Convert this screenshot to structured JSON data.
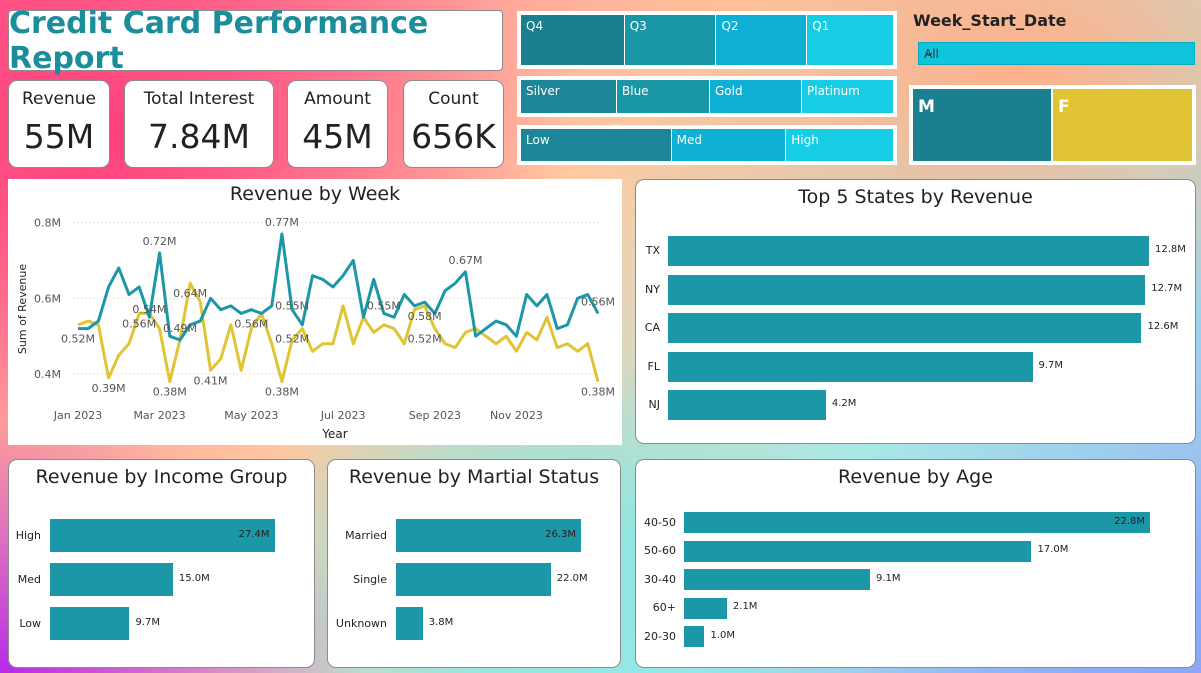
{
  "title": "Credit Card Performance Report",
  "kpis": [
    {
      "label": "Revenue",
      "value": "55M"
    },
    {
      "label": "Total Interest",
      "value": "7.84M"
    },
    {
      "label": "Amount",
      "value": "45M"
    },
    {
      "label": "Count",
      "value": "656K"
    }
  ],
  "slicers": {
    "quarters": [
      "Q4",
      "Q3",
      "Q2",
      "Q1"
    ],
    "card_categories": [
      "Silver",
      "Blue",
      "Gold",
      "Platinum"
    ],
    "levels": [
      "Low",
      "Med",
      "High"
    ]
  },
  "week_filter": {
    "label": "Week_Start_Date",
    "value": "All"
  },
  "gender": [
    "M",
    "F"
  ],
  "colors": {
    "teal": "#1b97a7",
    "yellow": "#e0c434",
    "title": "#1a8e9a"
  },
  "icons": {
    "dropdown": "chevron-down-icon"
  },
  "chart_data": [
    {
      "type": "line",
      "title": "Revenue by Week",
      "xlabel": "Year",
      "ylabel": "Sum of Revenue",
      "ylim": [
        0.35,
        0.82
      ],
      "y_ticks": [
        "0.8M",
        "0.6M",
        "0.4M"
      ],
      "y_tick_values": [
        0.8,
        0.6,
        0.4
      ],
      "x_ticks": [
        "Jan 2023",
        "Mar 2023",
        "May 2023",
        "Jul 2023",
        "Sep 2023",
        "Nov 2023"
      ],
      "x_tick_weeks": [
        1,
        9,
        18,
        27,
        36,
        44
      ],
      "x": [
        1,
        2,
        3,
        4,
        5,
        6,
        7,
        8,
        9,
        10,
        11,
        12,
        13,
        14,
        15,
        16,
        17,
        18,
        19,
        20,
        21,
        22,
        23,
        24,
        25,
        26,
        27,
        28,
        29,
        30,
        31,
        32,
        33,
        34,
        35,
        36,
        37,
        38,
        39,
        40,
        41,
        42,
        43,
        44,
        45,
        46,
        47,
        48,
        49,
        50,
        51,
        52
      ],
      "series": [
        {
          "values": [
            0.52,
            0.52,
            0.54,
            0.63,
            0.68,
            0.61,
            0.63,
            0.55,
            0.72,
            0.5,
            0.49,
            0.53,
            0.54,
            0.6,
            0.57,
            0.58,
            0.56,
            0.57,
            0.56,
            0.58,
            0.77,
            0.57,
            0.53,
            0.66,
            0.65,
            0.63,
            0.66,
            0.7,
            0.55,
            0.65,
            0.56,
            0.55,
            0.61,
            0.58,
            0.59,
            0.56,
            0.62,
            0.64,
            0.67,
            0.5,
            0.52,
            0.54,
            0.53,
            0.5,
            0.61,
            0.58,
            0.61,
            0.52,
            0.53,
            0.6,
            0.61,
            0.56
          ]
        },
        {
          "values": [
            0.53,
            0.54,
            0.53,
            0.39,
            0.45,
            0.48,
            0.56,
            0.56,
            0.52,
            0.38,
            0.49,
            0.64,
            0.59,
            0.41,
            0.44,
            0.53,
            0.41,
            0.52,
            0.56,
            0.48,
            0.38,
            0.49,
            0.52,
            0.46,
            0.48,
            0.48,
            0.58,
            0.48,
            0.55,
            0.51,
            0.53,
            0.52,
            0.48,
            0.57,
            0.58,
            0.52,
            0.48,
            0.47,
            0.51,
            0.52,
            0.5,
            0.48,
            0.5,
            0.46,
            0.51,
            0.49,
            0.55,
            0.47,
            0.48,
            0.46,
            0.48,
            0.38
          ]
        }
      ],
      "data_labels": [
        {
          "text": "0.52M",
          "week": 1,
          "value": 0.52,
          "series": 1
        },
        {
          "text": "0.39M",
          "week": 4,
          "value": 0.39,
          "series": 1
        },
        {
          "text": "0.56M",
          "week": 7,
          "value": 0.56,
          "series": 1
        },
        {
          "text": "0.54M",
          "week": 8,
          "value": 0.54,
          "series": 0
        },
        {
          "text": "0.72M",
          "week": 9,
          "value": 0.72,
          "series": 0
        },
        {
          "text": "0.38M",
          "week": 10,
          "value": 0.38,
          "series": 1
        },
        {
          "text": "0.49M",
          "week": 11,
          "value": 0.49,
          "series": 0
        },
        {
          "text": "0.64M",
          "week": 12,
          "value": 0.64,
          "series": 1
        },
        {
          "text": "0.41M",
          "week": 14,
          "value": 0.41,
          "series": 1
        },
        {
          "text": "0.56M",
          "week": 18,
          "value": 0.56,
          "series": 1
        },
        {
          "text": "0.38M",
          "week": 21,
          "value": 0.38,
          "series": 1
        },
        {
          "text": "0.77M",
          "week": 21,
          "value": 0.77,
          "series": 0
        },
        {
          "text": "0.55M",
          "week": 22,
          "value": 0.55,
          "series": 0
        },
        {
          "text": "0.52M",
          "week": 22,
          "value": 0.52,
          "series": 1
        },
        {
          "text": "0.55M",
          "week": 31,
          "value": 0.55,
          "series": 0
        },
        {
          "text": "0.52M",
          "week": 35,
          "value": 0.52,
          "series": 1
        },
        {
          "text": "0.58M",
          "week": 35,
          "value": 0.58,
          "series": 1
        },
        {
          "text": "0.67M",
          "week": 39,
          "value": 0.67,
          "series": 0
        },
        {
          "text": "0.56M",
          "week": 52,
          "value": 0.56,
          "series": 0
        },
        {
          "text": "0.38M",
          "week": 52,
          "value": 0.38,
          "series": 1
        }
      ]
    },
    {
      "type": "bar",
      "title": "Top 5 States by Revenue",
      "categories": [
        "TX",
        "NY",
        "CA",
        "FL",
        "NJ"
      ],
      "values": [
        12.8,
        12.7,
        12.6,
        9.7,
        4.2
      ],
      "value_labels": [
        "12.8M",
        "12.7M",
        "12.6M",
        "9.7M",
        "4.2M"
      ],
      "max": 12.8
    },
    {
      "type": "bar",
      "title": "Revenue by Income Group",
      "categories": [
        "High",
        "Med",
        "Low"
      ],
      "values": [
        27.4,
        15.0,
        9.7
      ],
      "value_labels": [
        "27.4M",
        "15.0M",
        "9.7M"
      ],
      "max": 31
    },
    {
      "type": "bar",
      "title": "Revenue by Martial Status",
      "categories": [
        "Married",
        "Single",
        "Unknown"
      ],
      "values": [
        26.3,
        22.0,
        3.8
      ],
      "value_labels": [
        "26.3M",
        "22.0M",
        "3.8M"
      ],
      "max": 29
    },
    {
      "type": "bar",
      "title": "Revenue by Age",
      "categories": [
        "40-50",
        "50-60",
        "30-40",
        "60+",
        "20-30"
      ],
      "values": [
        22.8,
        17.0,
        9.1,
        2.1,
        1.0
      ],
      "value_labels": [
        "22.8M",
        "17.0M",
        "9.1M",
        "2.1M",
        "1.0M"
      ],
      "max": 22.8
    }
  ]
}
